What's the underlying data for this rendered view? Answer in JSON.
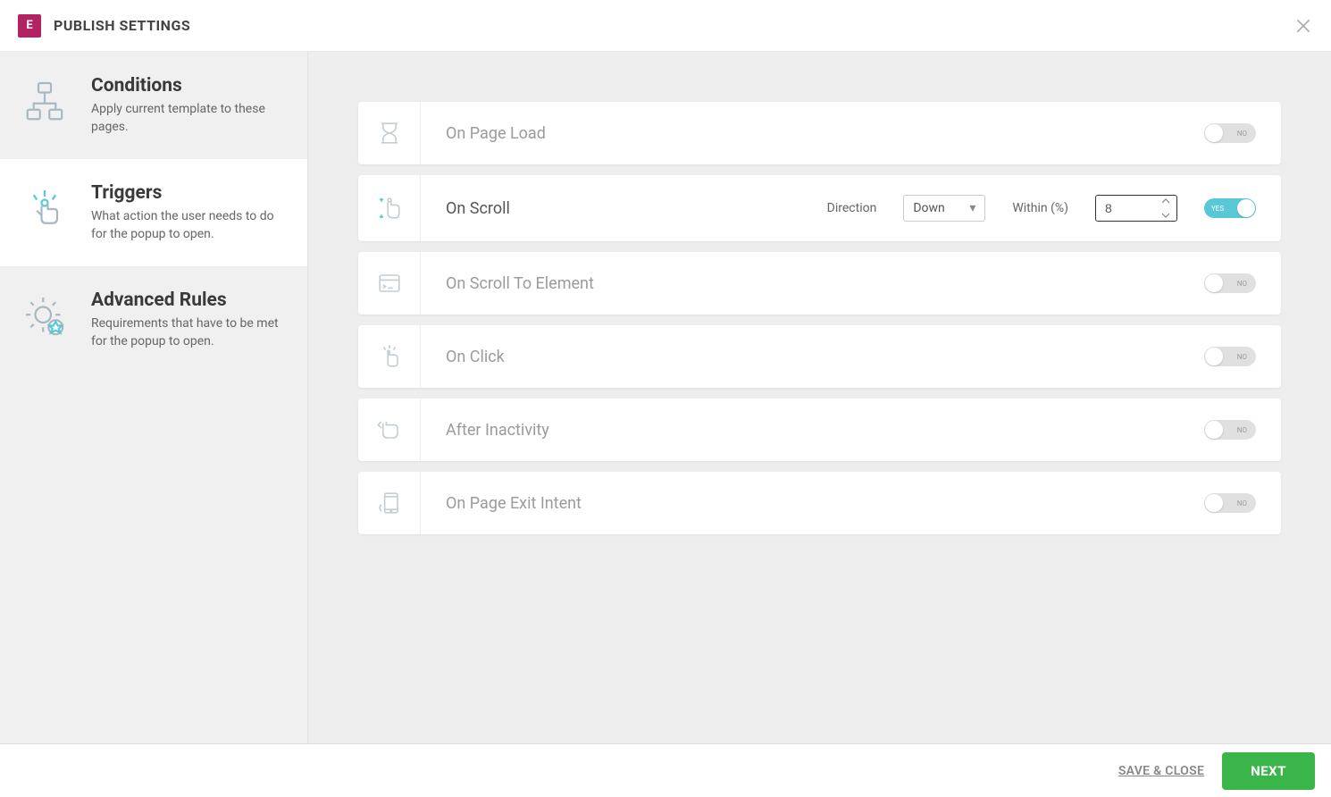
{
  "header": {
    "title": "PUBLISH SETTINGS"
  },
  "sidebar": {
    "items": [
      {
        "title": "Conditions",
        "desc": "Apply current template to these pages."
      },
      {
        "title": "Triggers",
        "desc": "What action the user needs to do for the popup to open."
      },
      {
        "title": "Advanced Rules",
        "desc": "Requirements that have to be met for the popup to open."
      }
    ]
  },
  "triggers": {
    "page_load": {
      "label": "On Page Load",
      "toggle": "NO"
    },
    "scroll": {
      "label": "On Scroll",
      "direction_label": "Direction",
      "direction_value": "Down",
      "within_label": "Within (%)",
      "within_value": "8",
      "toggle": "YES"
    },
    "scroll_to_element": {
      "label": "On Scroll To Element",
      "toggle": "NO"
    },
    "on_click": {
      "label": "On Click",
      "toggle": "NO"
    },
    "inactivity": {
      "label": "After Inactivity",
      "toggle": "NO"
    },
    "exit_intent": {
      "label": "On Page Exit Intent",
      "toggle": "NO"
    }
  },
  "footer": {
    "save": "SAVE & CLOSE",
    "next": "NEXT"
  }
}
